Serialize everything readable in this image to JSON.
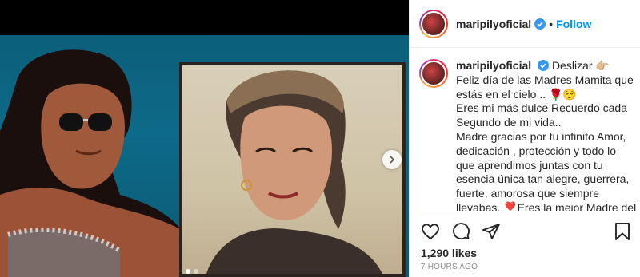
{
  "header": {
    "username": "maripilyoficial",
    "separator": "•",
    "follow_label": "Follow"
  },
  "caption": {
    "username": "maripilyoficial",
    "lines": [
      "Deslizar 👉🏼",
      "Feliz día de las Madres Mamita que estás en el cielo .. 🌹😌",
      "Eres mi más dulce Recuerdo cada Segundo de mi vida..",
      "Madre gracias por tu infinito Amor, dedicación , protección y todo lo que aprendimos juntas con tu esencia única tan alegre, guerrera, fuerte, amorosa que siempre llevabas. ❣️Eres la mejor Madre del mundo ,😘Extraño tenerte"
    ]
  },
  "actions": {
    "likes": "1,290 likes",
    "time": "7 HOURS AGO"
  },
  "icons": {
    "like": "heart-icon",
    "comment": "comment-icon",
    "share": "share-icon",
    "save": "bookmark-icon",
    "verified": "verified-badge-icon",
    "next": "chevron-right-icon"
  },
  "colors": {
    "accent": "#0095f6",
    "verified": "#3897f0",
    "muted": "#8e8e8e",
    "text": "#262626"
  },
  "carousel": {
    "slide_count": 2,
    "active_index": 0
  }
}
